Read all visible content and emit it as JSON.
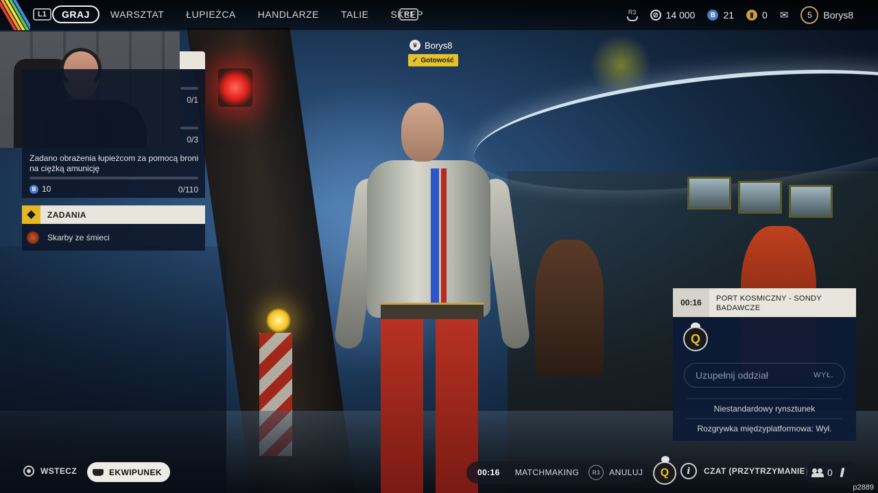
{
  "topbar": {
    "l1_hint": "L1",
    "r1_hint": "R1",
    "tabs": [
      {
        "label": "GRAJ",
        "active": true
      },
      {
        "label": "WARSZTAT",
        "active": false
      },
      {
        "label": "ŁUPIEŻCA",
        "active": false
      },
      {
        "label": "HANDLARZE",
        "active": false
      },
      {
        "label": "TALIE",
        "active": false
      },
      {
        "label": "SKLEP",
        "active": false
      }
    ],
    "r3_hint": "R3",
    "credits": "14 000",
    "tokens": "21",
    "premium": "0",
    "player_level": "5",
    "player_name": "Borys8"
  },
  "challenges": {
    "rows": [
      {
        "count": "0/1",
        "progress": 0
      },
      {
        "count": "0/3",
        "progress": 0
      },
      {
        "count": "0/110",
        "progress": 0
      }
    ],
    "active_description": "Zadano obrażenia łupieżcom za pomocą broni na ciężką amunicję",
    "reward_value": "10"
  },
  "quests": {
    "title": "ZADANIA",
    "items": [
      {
        "label": "Skarby ze śmieci"
      }
    ]
  },
  "player_tag": {
    "name": "Borys8",
    "status": "Gotowość"
  },
  "squad": {
    "timer": "00:16",
    "map_name": "PORT KOSMICZNY - SONDY BADAWCZE",
    "emblem_letter": "Q",
    "fill_label": "Uzupełnij oddział",
    "fill_state": "WYŁ.",
    "loadout_option": "Niestandardowy rynsztunek",
    "crossplay_option": "Rozgrywka międzyplatformowa: Wył."
  },
  "bottombar": {
    "back_label": "WSTECZ",
    "equipment_label": "EKWIPUNEK",
    "mm_timer": "00:16",
    "matchmaking_label": "MATCHMAKING",
    "cancel_hint": "R3",
    "cancel_label": "ANULUJ",
    "emblem_letter": "Q",
    "chat_label": "CZAT (PRZYTRZYMANIE)",
    "friends_count": "0"
  },
  "watermark": "p2889",
  "colors": {
    "accent_yellow": "#e6c22a",
    "panel_light": "#e8e6dc",
    "panel_dark": "#0e1628",
    "squad_blue": "#0c1a36"
  }
}
